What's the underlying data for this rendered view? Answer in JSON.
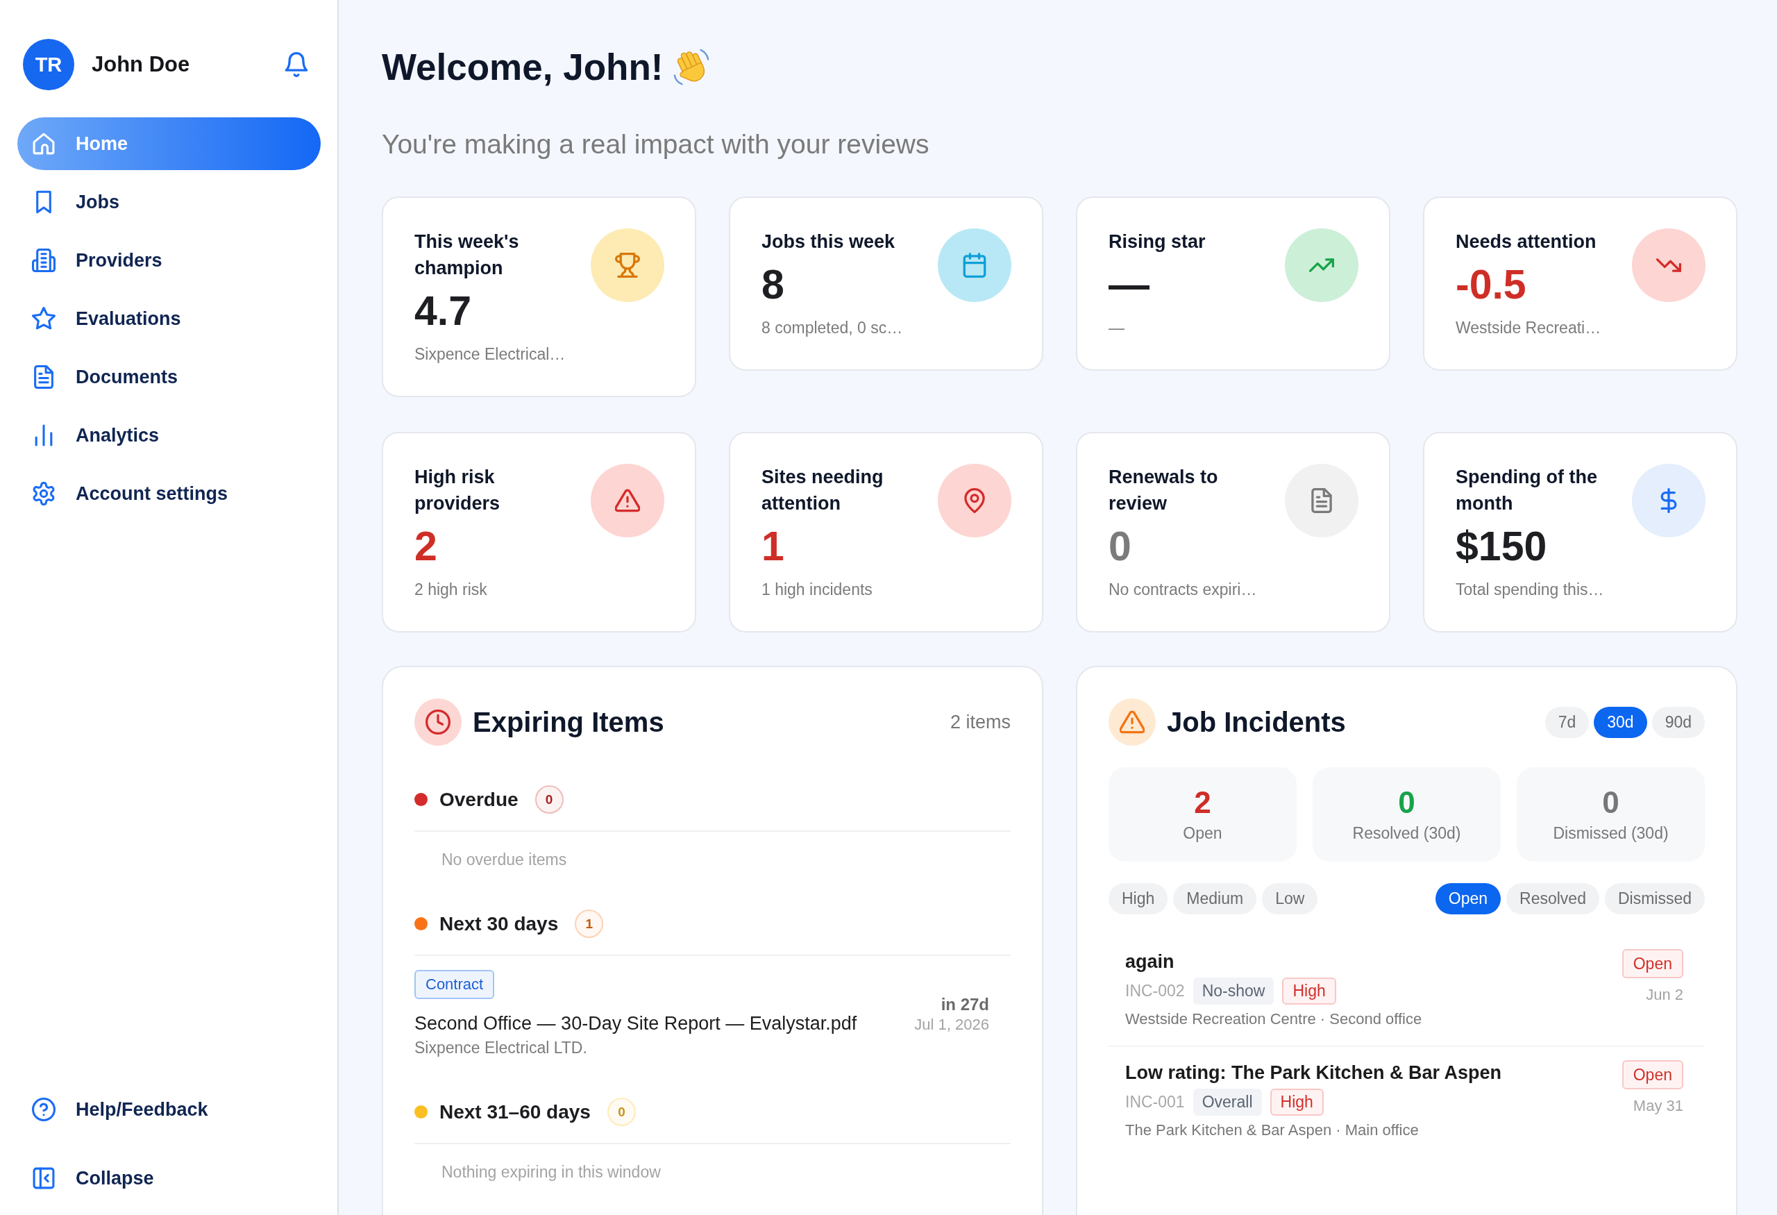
{
  "sidebar": {
    "user": {
      "initials": "TR",
      "name": "John Doe"
    },
    "nav_items": [
      {
        "label": "Home",
        "selected": true
      },
      {
        "label": "Jobs",
        "selected": false
      },
      {
        "label": "Providers",
        "selected": false
      },
      {
        "label": "Evaluations",
        "selected": false
      },
      {
        "label": "Documents",
        "selected": false
      },
      {
        "label": "Analytics",
        "selected": false
      },
      {
        "label": "Account settings",
        "selected": false
      }
    ],
    "footer_items": [
      {
        "label": "Help/Feedback"
      },
      {
        "label": "Collapse"
      }
    ]
  },
  "header": {
    "title": "Welcome, John!",
    "subtitle": "You're making a real impact with your reviews"
  },
  "stat_cards": [
    {
      "title": "This week's champion",
      "value": "4.7",
      "color": "#1e1f22",
      "subtitle": "Sixpence Electrical…"
    },
    {
      "title": "Jobs this week",
      "value": "8",
      "color": "#1e1f22",
      "subtitle": "8 completed, 0 sc…"
    },
    {
      "title": "Rising star",
      "value": "—",
      "color": "#1e1f22",
      "subtitle": "—"
    },
    {
      "title": "Needs attention",
      "value": "-0.5",
      "color": "#cf2e26",
      "subtitle": "Westside Recreati…"
    },
    {
      "title": "High risk providers",
      "value": "2",
      "color": "#cf2e26",
      "subtitle": "2 high risk"
    },
    {
      "title": "Sites needing attention",
      "value": "1",
      "color": "#cf2e26",
      "subtitle": "1 high incidents"
    },
    {
      "title": "Renewals to review",
      "value": "0",
      "color": "#7b7b7b",
      "subtitle": "No contracts expiri…"
    },
    {
      "title": "Spending of the month",
      "value": "$150",
      "color": "#1e1f22",
      "subtitle": "Total spending this…"
    }
  ],
  "expiring_items": {
    "title": "Expiring Items",
    "count": "2 items",
    "groups": [
      {
        "label": "Overdue",
        "color": "#d42b2b",
        "count": "0",
        "empty_text": "No overdue items"
      },
      {
        "label": "Next 30 days",
        "color": "#f97316",
        "count": "1",
        "items": [
          {
            "tag": "Contract",
            "title": "Second Office — 30-Day Site Report — Evalystar.pdf",
            "subtitle": "Sixpence Electrical LTD.",
            "due": "in 27d",
            "date": "Jul 1, 2026"
          }
        ]
      },
      {
        "label": "Next 31–60 days",
        "color": "#fbbf24",
        "count": "0",
        "empty_text": "Nothing expiring in this window"
      }
    ]
  },
  "job_incidents": {
    "title": "Job Incidents",
    "ranges": [
      {
        "label": "7d",
        "selected": false
      },
      {
        "label": "30d",
        "selected": true
      },
      {
        "label": "90d",
        "selected": false
      }
    ],
    "stats": [
      {
        "value": "2",
        "label": "Open",
        "color": "#cf2e26"
      },
      {
        "value": "0",
        "label": "Resolved (30d)",
        "color": "#16a34a"
      },
      {
        "value": "0",
        "label": "Dismissed (30d)",
        "color": "#777777"
      }
    ],
    "severity_filters": [
      {
        "label": "High",
        "selected": false
      },
      {
        "label": "Medium",
        "selected": false
      },
      {
        "label": "Low",
        "selected": false
      }
    ],
    "status_filters": [
      {
        "label": "Open",
        "selected": true
      },
      {
        "label": "Resolved",
        "selected": false
      },
      {
        "label": "Dismissed",
        "selected": false
      }
    ],
    "incidents": [
      {
        "title": "again",
        "id": "INC-002",
        "category": "No-show",
        "severity": "High",
        "location": "Westside Recreation Centre · Second office",
        "status": "Open",
        "date": "Jun 2"
      },
      {
        "title": "Low rating: The Park Kitchen & Bar Aspen",
        "id": "INC-001",
        "category": "Overall",
        "severity": "High",
        "location": "The Park Kitchen & Bar Aspen · Main office",
        "status": "Open",
        "date": "May 31"
      }
    ]
  }
}
